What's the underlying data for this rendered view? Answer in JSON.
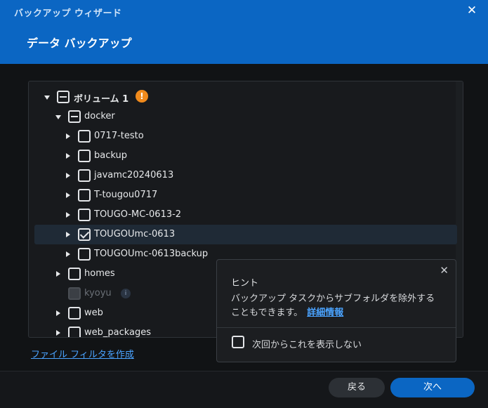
{
  "window": {
    "wizard_title": "バックアップ ウィザード",
    "close_symbol": "✕",
    "page_title": "データ バックアップ"
  },
  "tree": {
    "volume": {
      "label": "ボリューム 1",
      "state": "partial",
      "warning": "!"
    },
    "docker": {
      "label": "docker",
      "state": "partial"
    },
    "docker_children": [
      {
        "label": "0717-testo",
        "state": "unchecked"
      },
      {
        "label": "backup",
        "state": "unchecked"
      },
      {
        "label": "javamc20240613",
        "state": "unchecked"
      },
      {
        "label": "T-tougou0717",
        "state": "unchecked"
      },
      {
        "label": "TOUGO-MC-0613-2",
        "state": "unchecked"
      },
      {
        "label": "TOUGOUmc-0613",
        "state": "checked"
      },
      {
        "label": "TOUGOUmc-0613backup",
        "state": "unchecked"
      }
    ],
    "homes": {
      "label": "homes",
      "state": "unchecked"
    },
    "kyoyu": {
      "label": "kyoyu",
      "state": "disabled",
      "info": "i"
    },
    "web": {
      "label": "web",
      "state": "unchecked"
    },
    "web_packages": {
      "label": "web_packages",
      "state": "unchecked"
    }
  },
  "filter_link": "ファイル フィルタを作成",
  "hint": {
    "close_symbol": "✕",
    "title": "ヒント",
    "body": "バックアップ タスクからサブフォルダを除外することもできます。",
    "link": "詳細情報",
    "checkbox_label": "次回からこれを表示しない"
  },
  "footer": {
    "back_label": "戻る",
    "next_label": "次へ"
  },
  "colors": {
    "header": "#0b66c3",
    "accent": "#0b66c3",
    "link": "#4aa3ff",
    "warning": "#f08a1c",
    "background": "#111315"
  }
}
